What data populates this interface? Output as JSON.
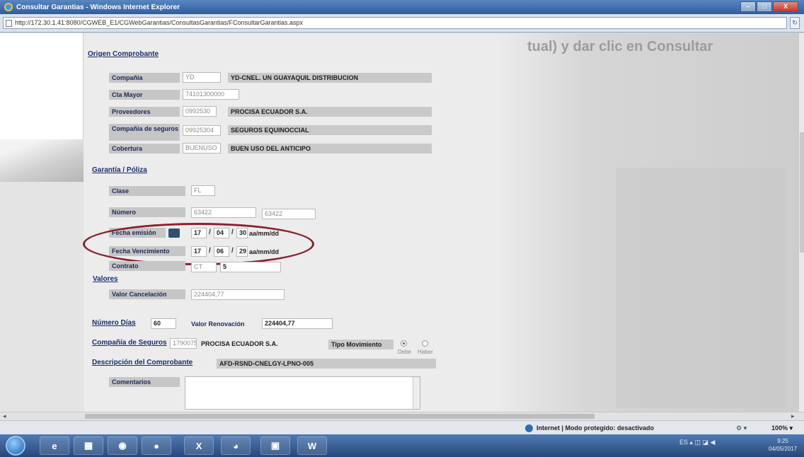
{
  "window": {
    "title": "Consultar Garantias - Windows Internet Explorer",
    "minimize_glyph": "–",
    "maximize_glyph": "□",
    "close_glyph": "X"
  },
  "address": {
    "url": "http://172.30.1.41:8080/CGWEB_E1/CGWebGarantias/ConsultasGarantias/FConsultarGarantias.aspx",
    "go_glyph": "↻"
  },
  "background_text": "tual) y dar clic en Consultar",
  "origen": {
    "title": "Origen Comprobante",
    "compania_label": "Compañia",
    "compania_code": "YD",
    "compania_name": "YD-CNEL. UN GUAYAQUIL DISTRIBUCION",
    "cta_mayor_label": "Cta Mayor",
    "cta_mayor_value": "74101300000",
    "proveedores_label": "Proveedores",
    "proveedores_code": "0992530",
    "proveedores_name": "PROCISA ECUADOR S.A.",
    "compania_seguros_label": "Compañia de seguros",
    "compania_seguros_code": "09925304",
    "compania_seguros_name": "SEGUROS EQUINOCCIAL",
    "cobertura_label": "Cobertura",
    "cobertura_code": "BUENUSO",
    "cobertura_name": "BUEN USO DEL ANTICIPO"
  },
  "garantia": {
    "title": "Garantía / Póliza",
    "clase_label": "Clase",
    "clase_value": "FL",
    "numero_label": "Número",
    "numero_value1": "63422",
    "numero_value2": "63422",
    "fecha_emision_label": "Fecha emisión",
    "fecha_emision": {
      "yy": "17",
      "mm": "04",
      "dd": "30"
    },
    "fecha_vencimiento_label": "Fecha Vencimiento",
    "fecha_vencimiento": {
      "yy": "17",
      "mm": "06",
      "dd": "29"
    },
    "date_separator": "/",
    "date_format": "aa/mm/dd",
    "contrato_label": "Contrato",
    "contrato_code": "CT",
    "contrato_value": "5"
  },
  "valores": {
    "title": "Valores",
    "valor_cancelacion_label": "Valor Cancelación",
    "valor_cancelacion_value": "224404,77",
    "numero_dias_label": "Número Días",
    "numero_dias_value": "60",
    "valor_renovacion_label": "Valor Renovación",
    "valor_renovacion_value": "224404,77",
    "compania_seguros_label": "Compañía de Seguros",
    "compania_seguros_code": "1790075",
    "compania_seguros_name": "PROCISA ECUADOR S.A.",
    "tipo_movimiento_label": "Tipo Movimiento",
    "debe_label": "Debe",
    "haber_label": "Haber",
    "descripcion_label": "Descripción del Comprobante",
    "descripcion_value": "AFD-RSND-CNELGY-LPNO-005",
    "comentarios_label": "Comentarios"
  },
  "status": {
    "zone": "Internet | Modo protegido: desactivado",
    "security_menu": "⚙ ▾",
    "zoom": "100% ▾"
  },
  "taskbar": {
    "clock_time": "9:25",
    "clock_date": "04/05/2017",
    "items": [
      "e",
      "▦",
      "◉",
      "●",
      "X",
      "◕",
      "▣",
      "W"
    ]
  }
}
